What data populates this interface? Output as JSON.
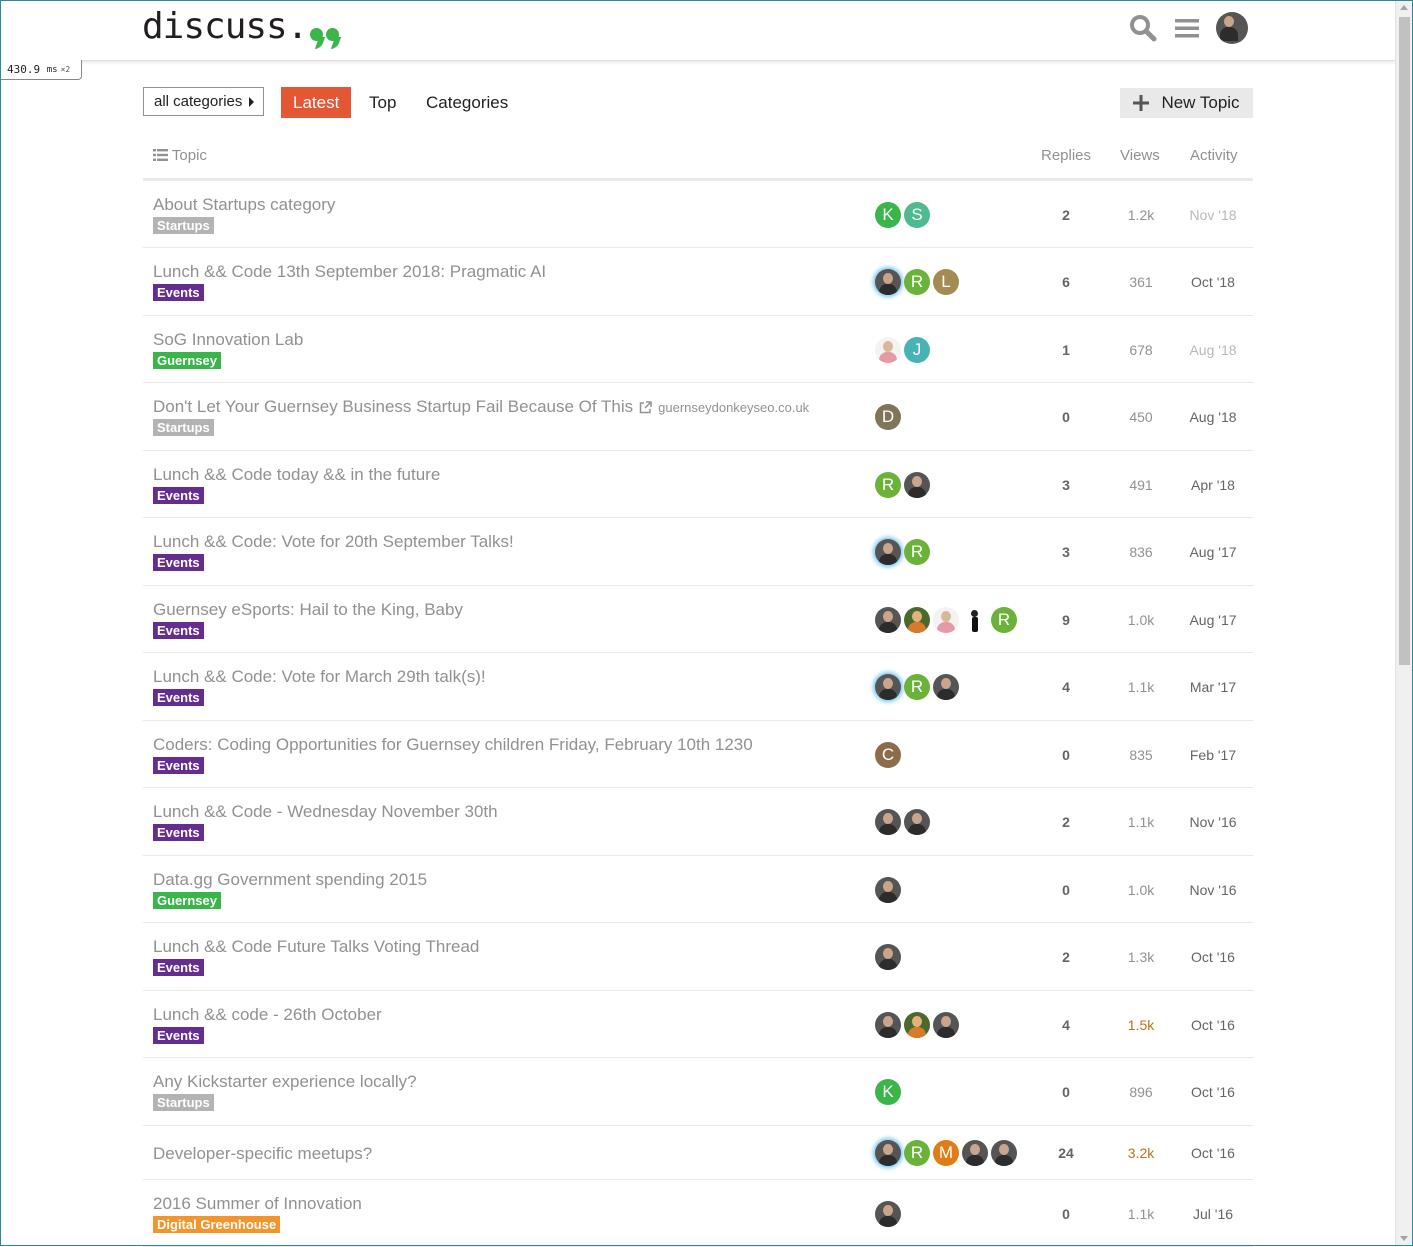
{
  "header": {
    "logo_text": "discuss",
    "logo_dot": ".",
    "search_icon": "search-icon",
    "menu_icon": "hamburger-icon",
    "avatar_icon": "user-avatar"
  },
  "perf": {
    "value": "430.9",
    "unit": "ms",
    "multiplier": "×2"
  },
  "nav": {
    "category_dropdown": "all categories",
    "tabs": [
      "Latest",
      "Top",
      "Categories"
    ],
    "active_tab": "Latest",
    "new_topic": "New Topic"
  },
  "table": {
    "columns": {
      "topic": "Topic",
      "replies": "Replies",
      "views": "Views",
      "activity": "Activity"
    },
    "rows": [
      {
        "title": "About Startups category",
        "category": "Startups",
        "cat_color": "#b3b3b3",
        "posters": [
          "K",
          "S"
        ],
        "replies": "2",
        "views": "1.2k",
        "activity": "Nov '18"
      },
      {
        "title": "Lunch && Code 13th September 2018: Pragmatic AI",
        "category": "Events",
        "cat_color": "#652d90",
        "posters": [
          "photo",
          "R",
          "L"
        ],
        "replies": "6",
        "views": "361",
        "activity": "Oct '18"
      },
      {
        "title": "SoG Innovation Lab",
        "category": "Guernsey",
        "cat_color": "#3ab54a",
        "posters": [
          "photo",
          "J"
        ],
        "replies": "1",
        "views": "678",
        "activity": "Aug '18"
      },
      {
        "title": "Don't Let Your Guernsey Business Startup Fail Because Of This",
        "domain": "guernseydonkeyseo.co.uk",
        "category": "Startups",
        "cat_color": "#b3b3b3",
        "posters": [
          "D"
        ],
        "replies": "0",
        "views": "450",
        "activity": "Aug '18"
      },
      {
        "title": "Lunch && Code today && in the future",
        "category": "Events",
        "cat_color": "#652d90",
        "posters": [
          "R",
          "photo"
        ],
        "replies": "3",
        "views": "491",
        "activity": "Apr '18"
      },
      {
        "title": "Lunch && Code: Vote for 20th September Talks!",
        "category": "Events",
        "cat_color": "#652d90",
        "posters": [
          "photo",
          "R"
        ],
        "replies": "3",
        "views": "836",
        "activity": "Aug '17"
      },
      {
        "title": "Guernsey eSports: Hail to the King, Baby",
        "category": "Events",
        "cat_color": "#652d90",
        "posters": [
          "photo",
          "photo",
          "photo",
          "photo",
          "R"
        ],
        "replies": "9",
        "views": "1.0k",
        "activity": "Aug '17"
      },
      {
        "title": "Lunch && Code: Vote for March 29th talk(s)!",
        "category": "Events",
        "cat_color": "#652d90",
        "posters": [
          "photo",
          "R",
          "photo"
        ],
        "replies": "4",
        "views": "1.1k",
        "activity": "Mar '17"
      },
      {
        "title": "Coders: Coding Opportunities for Guernsey children Friday, February 10th 1230",
        "category": "Events",
        "cat_color": "#652d90",
        "posters": [
          "C"
        ],
        "replies": "0",
        "views": "835",
        "activity": "Feb '17"
      },
      {
        "title": "Lunch && Code - Wednesday November 30th",
        "category": "Events",
        "cat_color": "#652d90",
        "posters": [
          "photo",
          "photo"
        ],
        "replies": "2",
        "views": "1.1k",
        "activity": "Nov '16"
      },
      {
        "title": "Data.gg Government spending 2015",
        "category": "Guernsey",
        "cat_color": "#3ab54a",
        "posters": [
          "photo"
        ],
        "replies": "0",
        "views": "1.0k",
        "activity": "Nov '16"
      },
      {
        "title": "Lunch && Code Future Talks Voting Thread",
        "category": "Events",
        "cat_color": "#652d90",
        "posters": [
          "photo"
        ],
        "replies": "2",
        "views": "1.3k",
        "activity": "Oct '16"
      },
      {
        "title": "Lunch && code - 26th October",
        "category": "Events",
        "cat_color": "#652d90",
        "posters": [
          "photo",
          "photo",
          "photo"
        ],
        "replies": "4",
        "views": "1.5k",
        "activity": "Oct '16"
      },
      {
        "title": "Any Kickstarter experience locally?",
        "category": "Startups",
        "cat_color": "#b3b3b3",
        "posters": [
          "K"
        ],
        "replies": "0",
        "views": "896",
        "activity": "Oct '16"
      },
      {
        "title": "Developer-specific meetups?",
        "category": "",
        "cat_color": "",
        "posters": [
          "photo",
          "R",
          "M",
          "photo",
          "photo"
        ],
        "replies": "24",
        "views": "3.2k",
        "activity": "Oct '16"
      },
      {
        "title": "2016 Summer of Innovation",
        "category": "Digital Greenhouse",
        "cat_color": "#f1952c",
        "posters": [
          "photo"
        ],
        "replies": "0",
        "views": "1.1k",
        "activity": "Jul '16"
      }
    ]
  }
}
